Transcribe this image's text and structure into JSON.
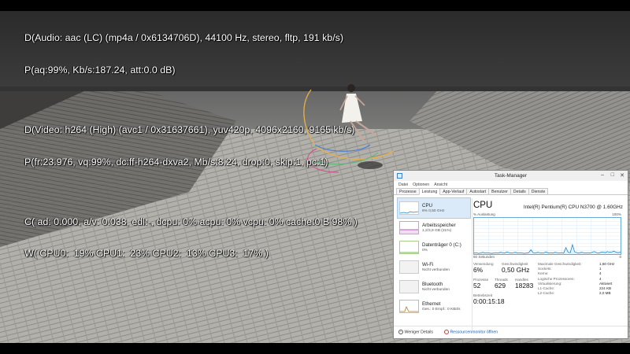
{
  "osd": {
    "audio_decoder": "D(Audio: aac (LC) (mp4a / 0x6134706D), 44100 Hz, stereo, fltp, 191 kb/s)",
    "audio_post": "P(aq:99%, Kb/s:187.24, att:0.0 dB)",
    "video_decoder": "D(Video: h264 (High) (avc1 / 0x31637661), yuv420p, 4096x2160, 9165 kb/s)",
    "video_post": "P(fr:23.976, vq:99%, dc:ff-h264-dxva2, Mb/s:8.24, drop:0, skip:1, pc:1)",
    "clock": "C( ad: 0.000, a/v: 0.038, edl:-, dcpu: 0% acpu: 0% vcpu: 0% cache:0 B 98% )",
    "cpu_load": "W( CPU0:  19% CPU1:  23% CPU2:  13% CPU3:  17% )"
  },
  "task_manager": {
    "title": "Task-Manager",
    "window_buttons": {
      "minimize": "–",
      "maximize": "□",
      "close": "✕"
    },
    "menu": [
      "Datei",
      "Optionen",
      "Ansicht"
    ],
    "tabs": [
      "Prozesse",
      "Leistung",
      "App-Verlauf",
      "Autostart",
      "Benutzer",
      "Details",
      "Dienste"
    ],
    "active_tab": "Leistung",
    "sidebar": [
      {
        "name": "CPU",
        "sub": "6% 0,50 GHz",
        "color": "#1e88c8",
        "active": true
      },
      {
        "name": "Arbeitsspeicher",
        "sub": "1,2/3,9 GB (31%)",
        "color": "#9c2da6",
        "active": false
      },
      {
        "name": "Datenträger 0 (C:)",
        "sub": "0%",
        "color": "#4d9a1e",
        "active": false
      },
      {
        "name": "Wi-Fi",
        "sub": "Nicht verbunden",
        "color": "#b0b0b0",
        "active": false
      },
      {
        "name": "Bluetooth",
        "sub": "Nicht verbunden",
        "color": "#b0b0b0",
        "active": false
      },
      {
        "name": "Ethernet",
        "sub": "Ges.: 0 Empf.: 0 KBit/s",
        "color": "#c0731e",
        "active": false
      }
    ],
    "panel": {
      "heading": "CPU",
      "model": "Intel(R) Pentium(R) CPU N3700 @ 1.60GHz",
      "y_axis_label": "% Auslastung",
      "y_axis_max": "100%",
      "x_axis_left": "60 Sekunden",
      "x_axis_right": "0",
      "usage_history": [
        3,
        4,
        2,
        3,
        5,
        3,
        4,
        3,
        2,
        3,
        4,
        3,
        5,
        4,
        3,
        6,
        4,
        3,
        4,
        5,
        3,
        4,
        3,
        2,
        3,
        4,
        12,
        4,
        3,
        5,
        4,
        3,
        4,
        6,
        3,
        4,
        3,
        5,
        4,
        3,
        4,
        3,
        18,
        5,
        4,
        26,
        6,
        4,
        3,
        5,
        4,
        3,
        4,
        3,
        5,
        7,
        4,
        3,
        5,
        6,
        4,
        7,
        5,
        6,
        8,
        5,
        4,
        6
      ],
      "usage_label": "Verwendung",
      "usage_value": "6%",
      "speed_label": "Geschwindigkeit",
      "speed_value": "0,50 GHz",
      "processes_label": "Prozesse",
      "processes_value": "52",
      "threads_label": "Threads",
      "threads_value": "629",
      "handles_label": "Handles",
      "handles_value": "18283",
      "uptime_label": "Betriebszeit",
      "uptime_value": "0:00:15:18",
      "specs": [
        {
          "k": "Maximale Geschwindigkeit:",
          "v": "1,60 GHz"
        },
        {
          "k": "Sockets:",
          "v": "1"
        },
        {
          "k": "Kerne:",
          "v": "4"
        },
        {
          "k": "Logische Prozessoren:",
          "v": "4"
        },
        {
          "k": "Virtualisierung:",
          "v": "Aktiviert"
        },
        {
          "k": "L1-Cache:",
          "v": "224 KB"
        },
        {
          "k": "L2-Cache:",
          "v": "2,0 MB"
        }
      ]
    },
    "footer": {
      "less_details": "Weniger Details",
      "resource_monitor": "Ressourcenmonitor öffnen"
    }
  }
}
